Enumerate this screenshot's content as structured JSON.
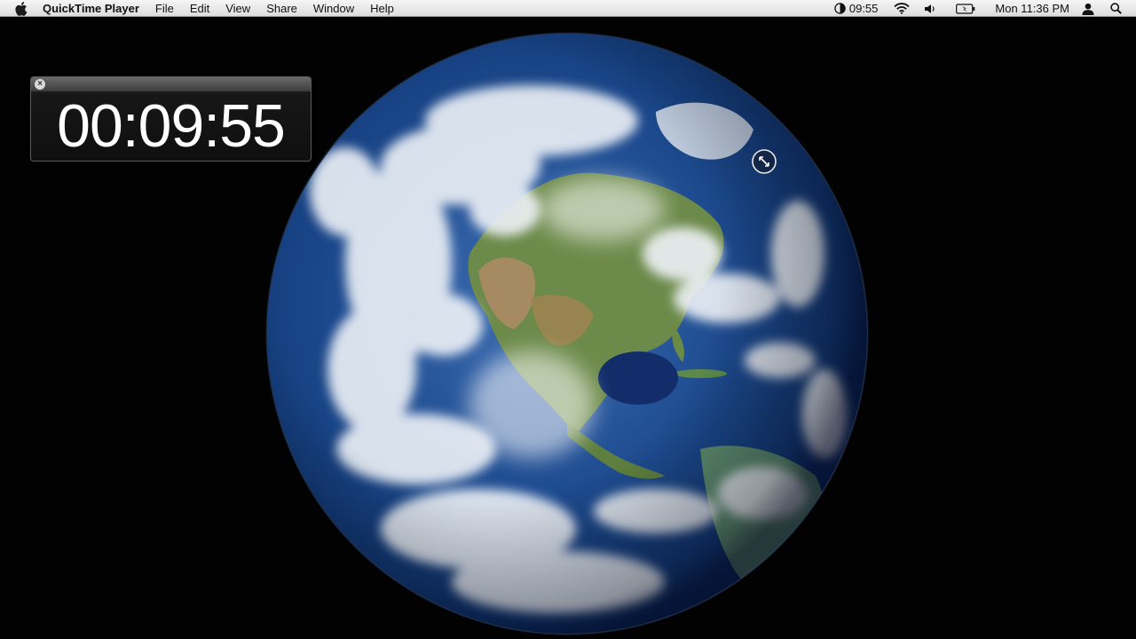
{
  "menubar": {
    "app_name": "QuickTime Player",
    "menus": [
      "File",
      "Edit",
      "View",
      "Share",
      "Window",
      "Help"
    ],
    "icons": {
      "apple": "apple-logo-icon",
      "clock": "clock-icon",
      "wifi": "wifi-icon",
      "volume": "volume-icon",
      "battery": "battery-icon",
      "user": "user-icon",
      "spotlight": "search-icon"
    },
    "clock_text": "09:55",
    "datetime": "Mon 11:36 PM"
  },
  "timer": {
    "display": "00:09:55"
  },
  "desktop": {
    "background_color": "#020203"
  },
  "cursor": {
    "icon": "resize-cursor-icon"
  }
}
